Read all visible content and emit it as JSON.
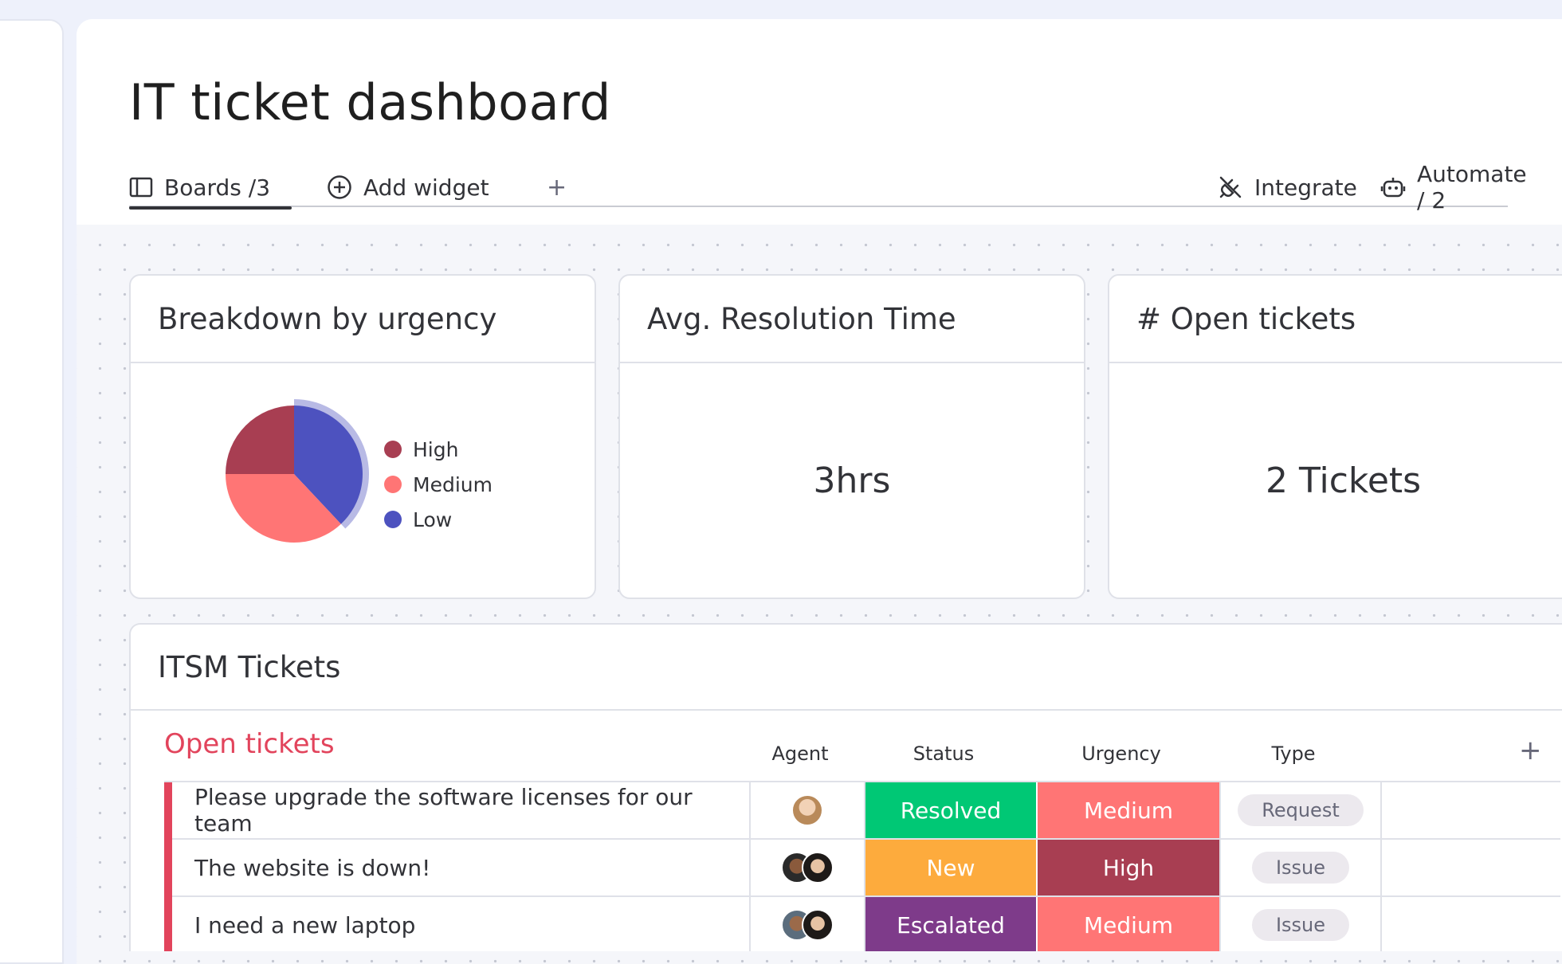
{
  "page": {
    "title": "IT ticket dashboard"
  },
  "tabs": {
    "boards": "Boards /3",
    "add_widget": "Add widget",
    "plus": "+",
    "integrate": "Integrate",
    "automate": "Automate / 2"
  },
  "widgets": {
    "urgency": {
      "title": "Breakdown by urgency",
      "legend": [
        {
          "label": "High",
          "color": "#a83e52"
        },
        {
          "label": "Medium",
          "color": "#ff7575"
        },
        {
          "label": "Low",
          "color": "#4d52bf"
        }
      ]
    },
    "resolution": {
      "title": "Avg. Resolution Time",
      "value": "3hrs"
    },
    "open": {
      "title": "# Open tickets",
      "value": "2 Tickets"
    }
  },
  "chart_data": {
    "type": "pie",
    "categories": [
      "High",
      "Medium",
      "Low"
    ],
    "values": [
      25,
      37,
      38
    ],
    "colors": [
      "#a83e52",
      "#ff7575",
      "#4d52bf"
    ],
    "legend": "right"
  },
  "tickets": {
    "title": "ITSM Tickets",
    "group": "Open tickets",
    "columns": {
      "agent": "Agent",
      "status": "Status",
      "urgency": "Urgency",
      "type": "Type",
      "add": "+"
    },
    "rows": [
      {
        "name": "Please upgrade the software licenses for our team",
        "agents": 1,
        "status": "Resolved",
        "status_color": "#00c875",
        "urgency": "Medium",
        "urgency_color": "#ff7575",
        "type": "Request"
      },
      {
        "name": "The website is down!",
        "agents": 2,
        "status": "New",
        "status_color": "#fdab3d",
        "urgency": "High",
        "urgency_color": "#a83e52",
        "type": "Issue"
      },
      {
        "name": "I need a new laptop",
        "agents": 2,
        "status": "Escalated",
        "status_color": "#7e3b8a",
        "urgency": "Medium",
        "urgency_color": "#ff7575",
        "type": "Issue"
      }
    ]
  }
}
